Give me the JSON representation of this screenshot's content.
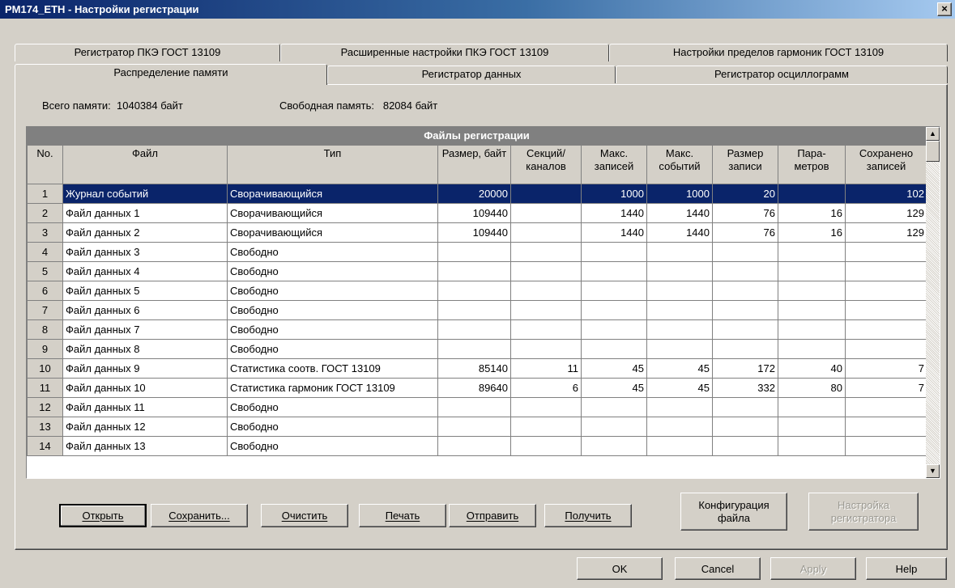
{
  "window": {
    "title": "PM174_ETH - Настройки регистрации",
    "close": "×"
  },
  "tabs_back": [
    "Регистратор ПКЭ ГОСТ 13109",
    "Расширенные настройки ПКЭ ГОСТ 13109",
    "Настройки пределов гармоник ГОСТ 13109"
  ],
  "tabs_front": [
    "Распределение памяти",
    "Регистратор данных",
    "Регистратор осциллограмм"
  ],
  "memory": {
    "total_label": "Всего памяти:",
    "total_value": "1040384 байт",
    "free_label": "Свободная память:",
    "free_value": "82084 байт"
  },
  "grid": {
    "title": "Файлы регистрации",
    "columns": [
      "No.",
      "Файл",
      "Тип",
      "Размер, байт",
      "Секций/ каналов",
      "Макс. записей",
      "Макс. событий",
      "Размер записи",
      "Пара- метров",
      "Сохранено записей"
    ],
    "rows": [
      [
        "1",
        "Журнал событий",
        "Сворачивающийся",
        "20000",
        "",
        "1000",
        "1000",
        "20",
        "",
        "102"
      ],
      [
        "2",
        "Файл данных 1",
        "Сворачивающийся",
        "109440",
        "",
        "1440",
        "1440",
        "76",
        "16",
        "129"
      ],
      [
        "3",
        "Файл данных 2",
        "Сворачивающийся",
        "109440",
        "",
        "1440",
        "1440",
        "76",
        "16",
        "129"
      ],
      [
        "4",
        "Файл данных 3",
        "Свободно",
        "",
        "",
        "",
        "",
        "",
        "",
        ""
      ],
      [
        "5",
        "Файл данных 4",
        "Свободно",
        "",
        "",
        "",
        "",
        "",
        "",
        ""
      ],
      [
        "6",
        "Файл данных 5",
        "Свободно",
        "",
        "",
        "",
        "",
        "",
        "",
        ""
      ],
      [
        "7",
        "Файл данных 6",
        "Свободно",
        "",
        "",
        "",
        "",
        "",
        "",
        ""
      ],
      [
        "8",
        "Файл данных 7",
        "Свободно",
        "",
        "",
        "",
        "",
        "",
        "",
        ""
      ],
      [
        "9",
        "Файл данных 8",
        "Свободно",
        "",
        "",
        "",
        "",
        "",
        "",
        ""
      ],
      [
        "10",
        "Файл данных 9",
        "Статистика соотв. ГОСТ 13109",
        "85140",
        "11",
        "45",
        "45",
        "172",
        "40",
        "7"
      ],
      [
        "11",
        "Файл данных 10",
        "Статистика гармоник ГОСТ 13109",
        "89640",
        "6",
        "45",
        "45",
        "332",
        "80",
        "7"
      ],
      [
        "12",
        "Файл данных 11",
        "Свободно",
        "",
        "",
        "",
        "",
        "",
        "",
        ""
      ],
      [
        "13",
        "Файл данных 12",
        "Свободно",
        "",
        "",
        "",
        "",
        "",
        "",
        ""
      ],
      [
        "14",
        "Файл данных 13",
        "Свободно",
        "",
        "",
        "",
        "",
        "",
        "",
        ""
      ]
    ]
  },
  "actions": {
    "open": "Открыть",
    "save": "Сохранить...",
    "clear": "Очистить",
    "print": "Печать",
    "send": "Отправить",
    "receive": "Получить",
    "file_config_1": "Конфигурация",
    "file_config_2": "файла",
    "recorder_setup_1": "Настройка",
    "recorder_setup_2": "регистратора"
  },
  "dialog": {
    "ok": "OK",
    "cancel": "Cancel",
    "apply": "Apply",
    "help": "Help"
  },
  "colors": {
    "selection": "#0a246a",
    "face": "#d4d0c8",
    "header": "#808080"
  }
}
